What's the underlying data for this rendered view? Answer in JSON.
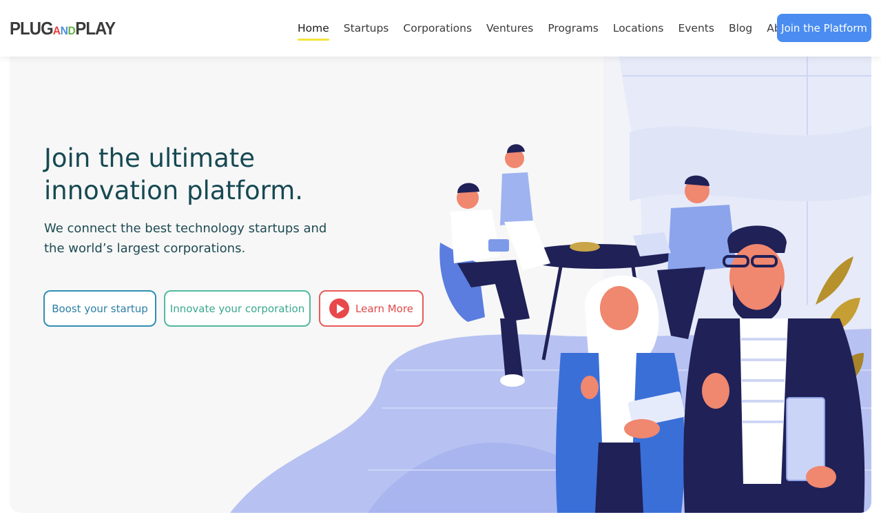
{
  "brand": {
    "logo_left": "PLUG",
    "logo_a": "A",
    "logo_n": "N",
    "logo_d": "D",
    "logo_right": "PLAY"
  },
  "nav": {
    "items": [
      {
        "label": "Home",
        "active": true
      },
      {
        "label": "Startups"
      },
      {
        "label": "Corporations"
      },
      {
        "label": "Ventures"
      },
      {
        "label": "Programs"
      },
      {
        "label": "Locations"
      },
      {
        "label": "Events"
      },
      {
        "label": "Blog"
      },
      {
        "label": "About"
      }
    ],
    "cta_label": "Join the Platform"
  },
  "hero": {
    "headline_line1": "Join the ultimate",
    "headline_line2": "innovation platform.",
    "subline_line1": "We connect the best technology startups and",
    "subline_line2": "the world’s largest corporations.",
    "buttons": {
      "startup": "Boost your startup",
      "corporation": "Innovate your corporation",
      "learn_more": "Learn More"
    },
    "illustration": "people-working-in-office-illustration"
  },
  "colors": {
    "accent_blue": "#4a8cf0",
    "nav_underline": "#f5e43b",
    "headline": "#164952",
    "startup_border": "#2f8fb0",
    "corp_border": "#52b8a0",
    "learn_border": "#e85a5a",
    "illustration_blue": "#9eaef0"
  }
}
